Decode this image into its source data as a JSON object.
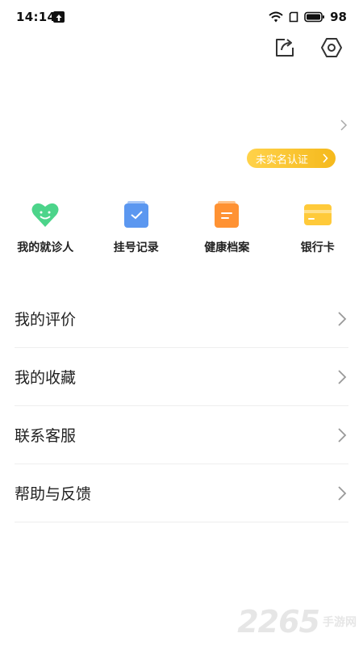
{
  "status_bar": {
    "time": "14:14",
    "battery": "98"
  },
  "header": {
    "share_icon": "share-icon",
    "settings_icon": "settings-icon"
  },
  "profile": {
    "verify_label": "未实名认证"
  },
  "quick_actions": [
    {
      "label": "我的就诊人",
      "icon": "heart-face-icon",
      "color": "#4cd48a"
    },
    {
      "label": "挂号记录",
      "icon": "calendar-check-icon",
      "color": "#5b97f0"
    },
    {
      "label": "健康档案",
      "icon": "clipboard-icon",
      "color": "#ff9233"
    },
    {
      "label": "银行卡",
      "icon": "bank-card-icon",
      "color": "#ffca3a"
    }
  ],
  "menu": [
    {
      "label": "我的评价"
    },
    {
      "label": "我的收藏"
    },
    {
      "label": "联系客服"
    },
    {
      "label": "帮助与反馈"
    }
  ],
  "watermark": {
    "number": "2265",
    "text": "手游网"
  },
  "colors": {
    "accent_yellow": "#f5b91c",
    "divider": "#eeeeee",
    "chevron": "#999999"
  }
}
